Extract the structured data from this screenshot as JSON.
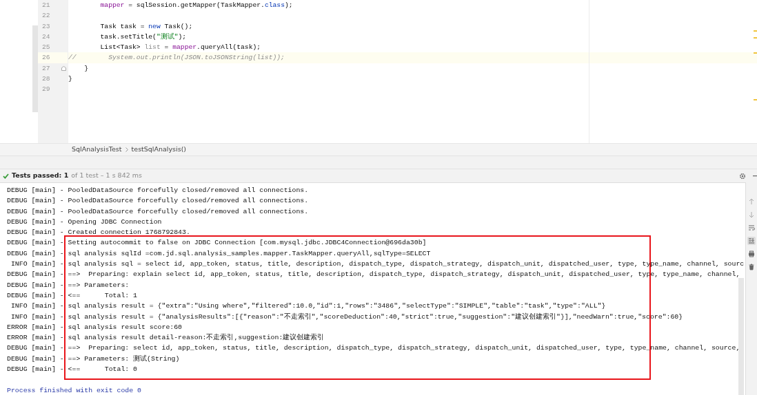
{
  "editor": {
    "lines": [
      {
        "number": "21",
        "tokens": [
          {
            "text": "        mapper",
            "kind": "field"
          },
          {
            "text": " = sqlSession.getMapper(TaskMapper."
          },
          {
            "text": "class",
            "kind": "keyword"
          },
          {
            "text": ");"
          }
        ]
      },
      {
        "number": "22"
      },
      {
        "number": "23",
        "tokens": [
          {
            "text": "        Task task = "
          },
          {
            "text": "new",
            "kind": "keyword"
          },
          {
            "text": " Task();"
          }
        ]
      },
      {
        "number": "24",
        "tokens": [
          {
            "text": "        task.setTitle("
          },
          {
            "text": "\"测试\"",
            "kind": "string"
          },
          {
            "text": ");"
          }
        ]
      },
      {
        "number": "25",
        "tokens": [
          {
            "text": "        List<Task> "
          },
          {
            "text": "list",
            "kind": "unused"
          },
          {
            "text": " = "
          },
          {
            "text": "mapper",
            "kind": "field"
          },
          {
            "text": ".queryAll(task);"
          }
        ]
      },
      {
        "number": "26",
        "current": true,
        "tokens": [
          {
            "text": "//        System.out.println(JSON.toJSONString(list));",
            "kind": "comment"
          }
        ]
      },
      {
        "number": "27",
        "fold": true,
        "tokens": [
          {
            "text": "    }"
          }
        ]
      },
      {
        "number": "28",
        "tokens": [
          {
            "text": "}"
          }
        ]
      },
      {
        "number": "29"
      }
    ]
  },
  "breadcrumbs": [
    "SqlAnalysisTest",
    "testSqlAnalysis()"
  ],
  "test_status": {
    "summary": "Tests passed: 1",
    "detail": "of 1 test – 1 s 842 ms"
  },
  "console": {
    "lines": [
      "DEBUG [main] - PooledDataSource forcefully closed/removed all connections.",
      "DEBUG [main] - PooledDataSource forcefully closed/removed all connections.",
      "DEBUG [main] - PooledDataSource forcefully closed/removed all connections.",
      "DEBUG [main] - Opening JDBC Connection",
      "DEBUG [main] - Created connection 1768792843."
    ],
    "highlighted_lines": [
      "DEBUG [main] - Setting autocommit to false on JDBC Connection [com.mysql.jdbc.JDBC4Connection@696da30b]",
      "DEBUG [main] - sql analysis sqlId =com.jd.sql.analysis_samples.mapper.TaskMapper.queryAll,sqlType=SELECT",
      " INFO [main] - sql analysis sql = select id, app_token, status, title, description, dispatch_type, dispatch_strategy, dispatch_unit, dispatched_user, type, type_name, channel, sourc",
      "DEBUG [main] - ==>  Preparing: explain select id, app_token, status, title, description, dispatch_type, dispatch_strategy, dispatch_unit, dispatched_user, type, type_name, channel,",
      "DEBUG [main] - ==> Parameters: ",
      "DEBUG [main] - <==      Total: 1",
      " INFO [main] - sql analysis result = {\"extra\":\"Using where\",\"filtered\":10.0,\"id\":1,\"rows\":\"3486\",\"selectType\":\"SIMPLE\",\"table\":\"task\",\"type\":\"ALL\"}",
      " INFO [main] - sql analysis result = {\"analysisResults\":[{\"reason\":\"不走索引\",\"scoreDeduction\":40,\"strict\":true,\"suggestion\":\"建议创建索引\"}],\"needWarn\":true,\"score\":60}",
      "ERROR [main] - sql analysis result score:60",
      "ERROR [main] - sql analysis result detail-reason:不走索引,suggestion:建议创建索引",
      "DEBUG [main] - ==>  Preparing: select id, app_token, status, title, description, dispatch_type, dispatch_strategy, dispatch_unit, dispatched_user, type, type_name, channel, source,",
      "DEBUG [main] - ==> Parameters: 测试(String)",
      "DEBUG [main] - <==      Total: 0"
    ],
    "exit_message": "Process finished with exit code 0"
  }
}
